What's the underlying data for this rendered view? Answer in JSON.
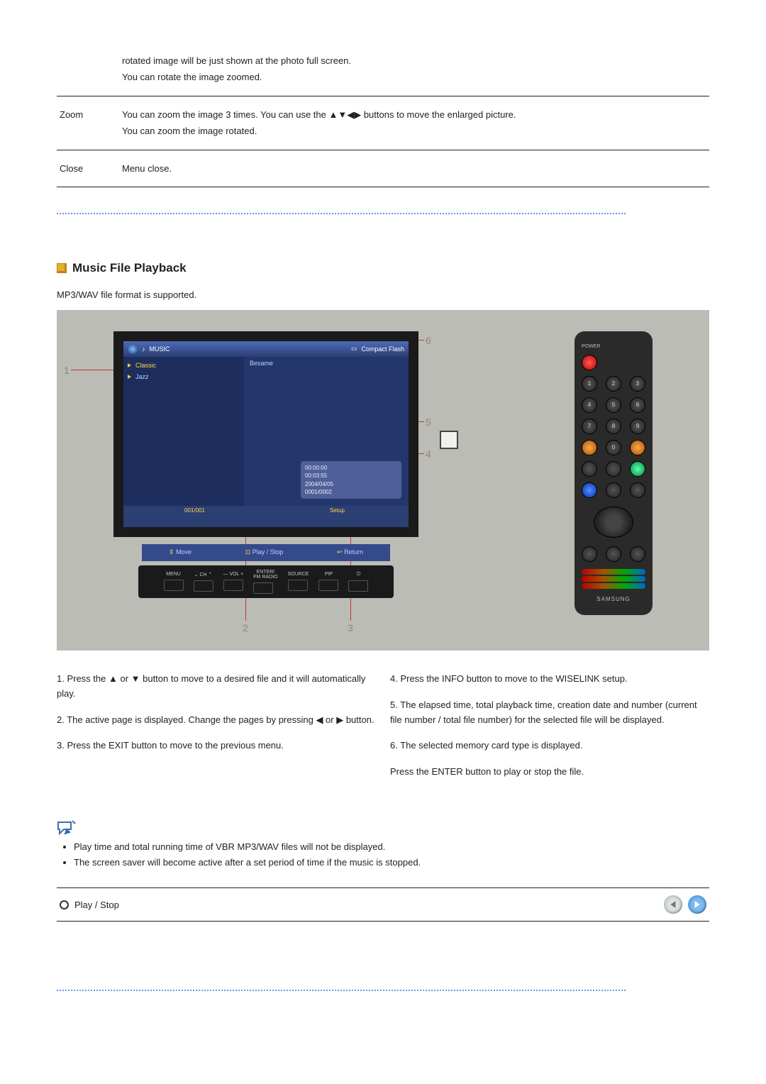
{
  "table": {
    "rows": [
      {
        "label": "",
        "desc": "rotated image will be just shown at the photo full screen.\nYou can rotate the image zoomed."
      },
      {
        "label": "Zoom",
        "desc": "You can zoom the image 3 times. You can use the ▲▼◀▶ buttons to move the enlarged picture.\nYou can zoom the image rotated."
      },
      {
        "label": "Close",
        "desc": "Menu close."
      }
    ]
  },
  "section": {
    "title": "Music File Playback",
    "support": "MP3/WAV file format is supported."
  },
  "monitor": {
    "topbar": {
      "label": "MUSIC",
      "card": "Compact Flash"
    },
    "list": [
      {
        "name": "Classic",
        "selected": true
      },
      {
        "name": "Jazz",
        "selected": false
      }
    ],
    "filename": "Besame",
    "info": {
      "elapsed": "00:00:00",
      "total": "00:03:55",
      "date": "2004/04/05",
      "count": "0001/0002"
    },
    "pager": "001/001",
    "setup": "Setup",
    "hints": {
      "move": "Move",
      "play": "Play / Stop",
      "return": "Return"
    },
    "keys": [
      "MENU",
      "CH",
      "",
      "VOL",
      "ENTER/\nFM RADIO",
      "SOURCE",
      "PIP",
      ""
    ]
  },
  "remote": {
    "brand": "SAMSUNG"
  },
  "callouts": {
    "c1": "1",
    "c2": "2",
    "c3": "3",
    "c4": "4",
    "c5": "5",
    "c6": "6"
  },
  "steps": {
    "left": [
      "1. Press the ▲ or ▼ button to move to a desired file and it will automatically play.",
      "2. The active page is displayed. Change the pages by pressing ◀ or ▶ button.",
      "3. Press the EXIT button to move to the previous menu."
    ],
    "right": [
      "4. Press the INFO button to move to the WISELINK setup.",
      "5. The elapsed time, total playback time, creation date and number (current file number / total file number) for the selected file will be displayed.",
      "6. The selected memory card type is displayed.",
      "Press the ENTER button to play or stop the file."
    ]
  },
  "notes": [
    "Play time and total running time of VBR MP3/WAV files will not be displayed.",
    "The screen saver will become active after a set period of time if the music is stopped."
  ],
  "playrow": {
    "label": "Play / Stop"
  }
}
